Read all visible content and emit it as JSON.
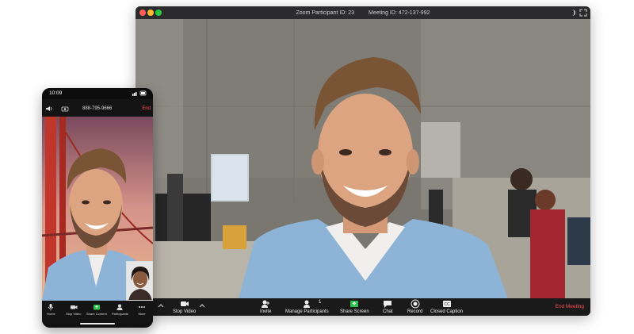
{
  "desktop": {
    "title_left": "Zoom Participant ID: 23",
    "title_right": "Meeting ID: 472-137-992",
    "toolbar": {
      "stop_video": "Stop Video",
      "invite": "Invite",
      "manage_participants": "Manage Participants",
      "participants_count": "1",
      "share_screen": "Share Screen",
      "chat": "Chat",
      "record": "Record",
      "closed_caption": "Closed Caption",
      "end_meeting": "End Meeting"
    }
  },
  "phone": {
    "time": "10:09",
    "meeting_id": "888-795-9666",
    "end_label": "End",
    "toolbar": {
      "home": "Home",
      "stop_video": "Stop Video",
      "share_content": "Share Content",
      "participants": "Participants",
      "more": "More"
    }
  },
  "colors": {
    "end_red": "#ff4d4d",
    "share_green": "#2ec04f",
    "toolbar_bg": "#1a1a1a"
  },
  "icons": {
    "desktop": [
      "stop-video-icon",
      "invite-icon",
      "manage-participants-icon",
      "share-screen-icon",
      "chat-icon",
      "record-icon",
      "closed-caption-icon",
      "fullscreen-icon"
    ],
    "phone": [
      "mic-icon",
      "video-camera-icon",
      "share-icon",
      "participants-icon",
      "more-icon"
    ]
  }
}
